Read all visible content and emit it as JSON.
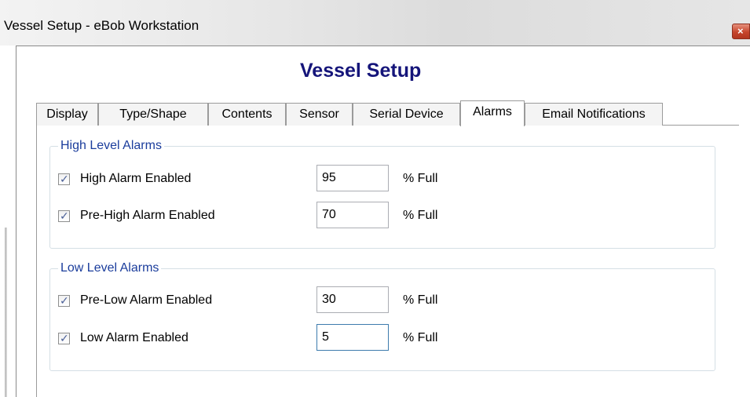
{
  "window": {
    "title": "Vessel Setup - eBob Workstation",
    "close_glyph": "×",
    "close_icon": "close-icon"
  },
  "header": {
    "title": "Vessel Setup",
    "color": "#15157a"
  },
  "tabs": [
    {
      "label": "Display",
      "selected": false
    },
    {
      "label": "Type/Shape",
      "selected": false
    },
    {
      "label": "Contents",
      "selected": false
    },
    {
      "label": "Sensor",
      "selected": false
    },
    {
      "label": "Serial Device",
      "selected": false
    },
    {
      "label": "Alarms",
      "selected": true
    },
    {
      "label": "Email Notifications",
      "selected": false
    }
  ],
  "high_level": {
    "legend": "High Level Alarms",
    "alarms": [
      {
        "label": "High Alarm Enabled",
        "checked": true,
        "value": "95",
        "unit": "% Full"
      },
      {
        "label": "Pre-High Alarm Enabled",
        "checked": true,
        "value": "70",
        "unit": "% Full"
      }
    ]
  },
  "low_level": {
    "legend": "Low Level Alarms",
    "alarms": [
      {
        "label": "Pre-Low Alarm Enabled",
        "checked": true,
        "value": "30",
        "unit": "% Full"
      },
      {
        "label": "Low Alarm Enabled",
        "checked": true,
        "value": "5",
        "unit": "% Full"
      }
    ]
  },
  "check_glyph": "✓",
  "colors": {
    "legend": "#1b3d9c",
    "checkmark": "#4a5f97",
    "close_button": "#c6452c"
  }
}
